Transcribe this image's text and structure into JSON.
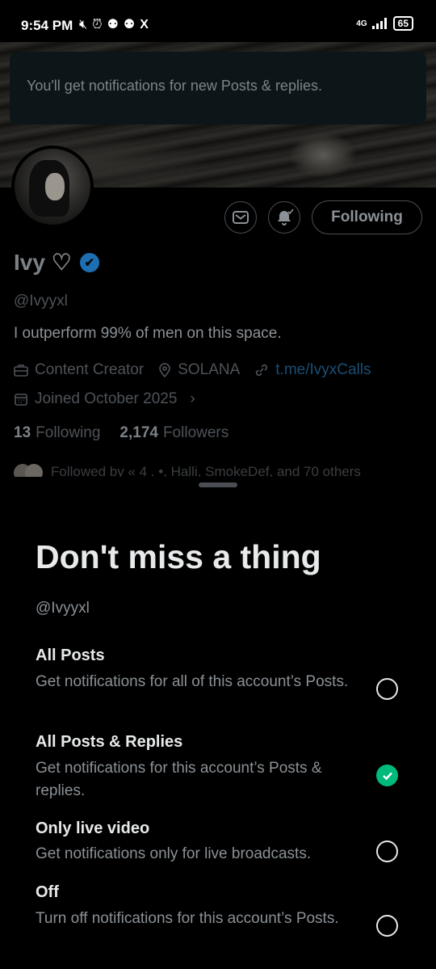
{
  "status_bar": {
    "time": "9:54 PM",
    "notification_icons": [
      "muted-mic-icon",
      "alarm-icon",
      "discord-icon",
      "discord-icon",
      "x-icon"
    ],
    "network": "4G",
    "battery": "65"
  },
  "toast": {
    "message": "You'll get notifications for new Posts & replies."
  },
  "profile": {
    "name": "Ivy ♡",
    "handle": "@Ivyyxl",
    "bio": "I outperform 99% of men on this space.",
    "category": "Content Creator",
    "location": "SOLANA",
    "website": "t.me/IvyxCalls",
    "joined": "Joined October 2025",
    "following_count": "13",
    "following_label": "Following",
    "followers_count": "2,174",
    "followers_label": "Followers",
    "followed_by": "Followed by « 4 . •, Halli, SmokeDef, and 70 others",
    "follow_button_label": "Following",
    "verified_color": "#1d9bf0"
  },
  "sheet": {
    "title": "Don't miss a thing",
    "handle": "@Ivyyxl",
    "options": [
      {
        "title": "All Posts",
        "desc": "Get notifications for all of this account’s Posts.",
        "selected": false
      },
      {
        "title": "All Posts & Replies",
        "desc": "Get notifications for this account’s Posts & replies.",
        "selected": true
      },
      {
        "title": "Only live video",
        "desc": "Get notifications only for live broadcasts.",
        "selected": false
      },
      {
        "title": "Off",
        "desc": "Turn off notifications for this account’s Posts.",
        "selected": false
      }
    ],
    "accent_color": "#00ba7c"
  }
}
